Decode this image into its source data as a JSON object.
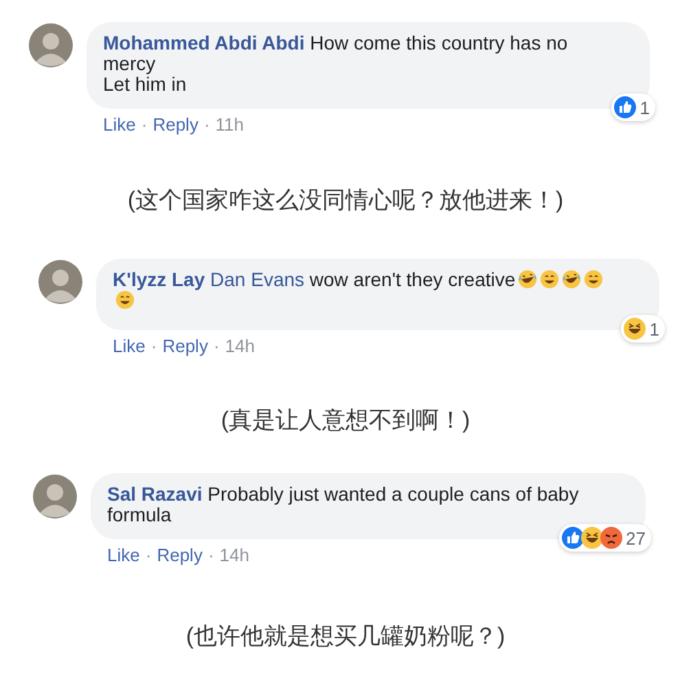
{
  "separator": "·",
  "comments": [
    {
      "author": "Mohammed Abdi Abdi",
      "text": "How come this country has no mercy\nLet him in",
      "actions": [
        "Like",
        "Reply"
      ],
      "time": "11h",
      "reactions": [
        {
          "kind": "like"
        }
      ],
      "reaction_count": "1",
      "translation": "(这个国家咋这么没同情心呢？放他进来！)"
    },
    {
      "author": "K'lyzz Lay",
      "mention": "Dan Evans",
      "text": "wow aren't they creative",
      "emojis": [
        {
          "kind": "laughing"
        },
        {
          "kind": "grinning"
        },
        {
          "kind": "laughing"
        },
        {
          "kind": "grinning"
        },
        {
          "kind": "grinning"
        }
      ],
      "actions": [
        "Like",
        "Reply"
      ],
      "time": "14h",
      "reactions": [
        {
          "kind": "haha"
        }
      ],
      "reaction_count": "1",
      "translation": "(真是让人意想不到啊！)"
    },
    {
      "author": "Sal Razavi",
      "text": "Probably just wanted a couple cans of baby formula",
      "actions": [
        "Like",
        "Reply"
      ],
      "time": "14h",
      "reactions": [
        {
          "kind": "like"
        },
        {
          "kind": "haha"
        },
        {
          "kind": "angry"
        }
      ],
      "reaction_count": "27",
      "translation": "(也许他就是想买几罐奶粉呢？)"
    }
  ]
}
